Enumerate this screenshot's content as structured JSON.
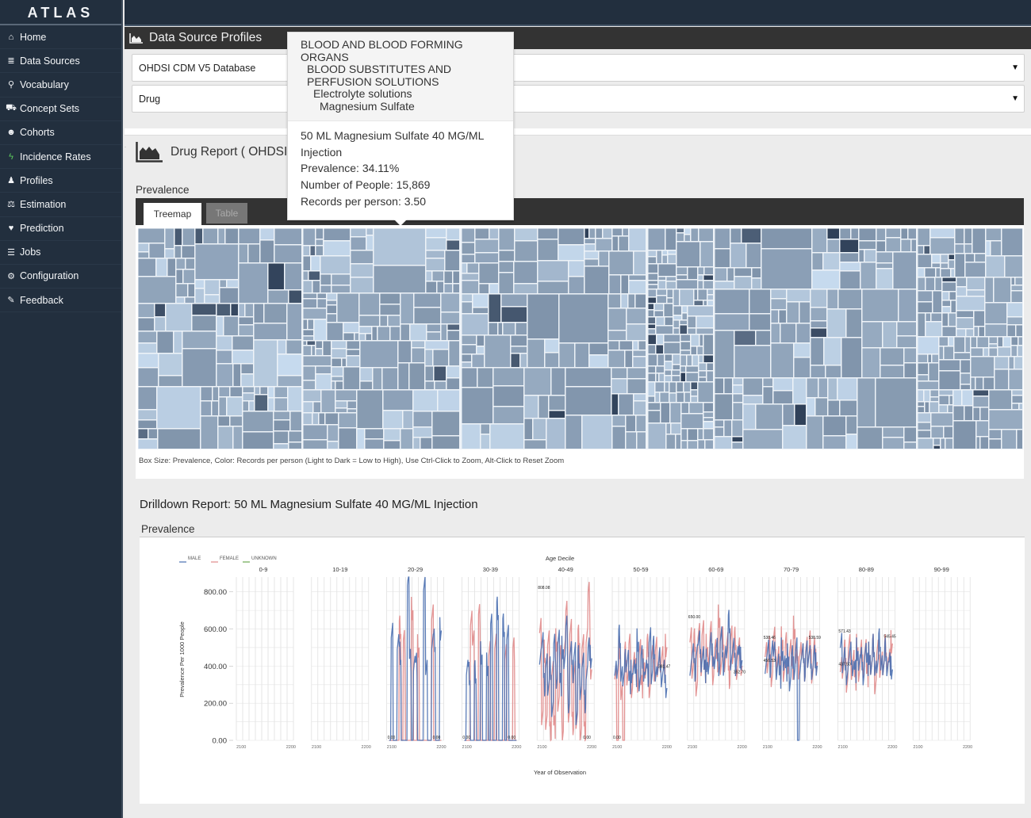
{
  "app": {
    "brand": "ATLAS"
  },
  "sidebar": {
    "items": [
      {
        "label": "Home",
        "icon": "home-icon",
        "glyph": "⌂"
      },
      {
        "label": "Data Sources",
        "icon": "database-icon",
        "glyph": "≣"
      },
      {
        "label": "Vocabulary",
        "icon": "search-icon",
        "glyph": "⚲"
      },
      {
        "label": "Concept Sets",
        "icon": "cart-icon",
        "glyph": "⛟"
      },
      {
        "label": "Cohorts",
        "icon": "users-icon",
        "glyph": "☻"
      },
      {
        "label": "Incidence Rates",
        "icon": "bolt-icon",
        "glyph": "ϟ"
      },
      {
        "label": "Profiles",
        "icon": "user-icon",
        "glyph": "♟"
      },
      {
        "label": "Estimation",
        "icon": "balance-scale-icon",
        "glyph": "⚖"
      },
      {
        "label": "Prediction",
        "icon": "heartbeat-icon",
        "glyph": "♥"
      },
      {
        "label": "Jobs",
        "icon": "tasks-icon",
        "glyph": "☰"
      },
      {
        "label": "Configuration",
        "icon": "cogs-icon",
        "glyph": "⚙"
      },
      {
        "label": "Feedback",
        "icon": "comment-icon",
        "glyph": "✎"
      }
    ]
  },
  "header": {
    "title": "Data Source Profiles"
  },
  "selectors": {
    "source": "OHDSI CDM V5 Database",
    "report": "Drug"
  },
  "report": {
    "title": "Drug Report ( OHDSI-C",
    "prevalence_label": "Prevalence",
    "tabs": [
      {
        "label": "Treemap",
        "active": true
      },
      {
        "label": "Table",
        "active": false
      }
    ],
    "treemap_caption": "Box Size: Prevalence, Color: Records per person (Light to Dark = Low to High), Use Ctrl-Click to Zoom, Alt-Click to Reset Zoom",
    "treemap_colors": {
      "light": "#c6daee",
      "mid": "#7f93aa",
      "dark": "#2d3e56"
    }
  },
  "tooltip": {
    "path": [
      "BLOOD AND BLOOD FORMING ORGANS",
      "BLOOD SUBSTITUTES AND PERFUSION SOLUTIONS",
      "Electrolyte solutions",
      "Magnesium Sulfate"
    ],
    "concept_name": "50 ML Magnesium Sulfate 40 MG/ML Injection",
    "prevalence": "Prevalence: 34.11%",
    "people": "Number of People: 15,869",
    "records": "Records per person: 3.50"
  },
  "drilldown": {
    "title": "Drilldown Report: 50 ML Magnesium Sulfate 40 MG/ML Injection",
    "prevalence_label": "Prevalence"
  },
  "chart_data": {
    "type": "line",
    "title": "Age Decile",
    "xlabel": "Year of Observation",
    "ylabel": "Prevalence Per 1000 People",
    "ylim": [
      0,
      880
    ],
    "yticks": [
      "0.00",
      "200.00",
      "400.00",
      "600.00",
      "800.00"
    ],
    "xticks": [
      "2100",
      "2200"
    ],
    "xlim": [
      2090,
      2205
    ],
    "grid": true,
    "legend": {
      "placement": "top-left",
      "entries": [
        {
          "name": "MALE",
          "color": "#4a6fb0"
        },
        {
          "name": "FEMALE",
          "color": "#e08a8a"
        },
        {
          "name": "UNKNOWN",
          "color": "#6aa84f"
        }
      ]
    },
    "panels": [
      {
        "label": "0-9",
        "annotations": []
      },
      {
        "label": "10-19",
        "annotations": []
      },
      {
        "label": "20-29",
        "annotations": [
          "0.00",
          "0.00"
        ]
      },
      {
        "label": "30-39",
        "annotations": [
          "0.00",
          "0.00"
        ]
      },
      {
        "label": "40-49",
        "annotations": [
          "808.08",
          "0.00"
        ]
      },
      {
        "label": "50-59",
        "annotations": [
          "0.00",
          "381.47"
        ]
      },
      {
        "label": "60-69",
        "annotations": [
          "650.00",
          "352.70"
        ]
      },
      {
        "label": "70-79",
        "annotations": [
          "538.46",
          "538.59",
          "456.53"
        ]
      },
      {
        "label": "80-89",
        "annotations": [
          "571.43",
          "545.45",
          "437.50"
        ]
      },
      {
        "label": "90-99",
        "annotations": []
      }
    ],
    "series_note": "Monthly prevalence per age decile; values approximated from dense line plots",
    "series": [
      {
        "name": "MALE",
        "panel": "20-29",
        "values": [
          0,
          570,
          0,
          0,
          500,
          460,
          0,
          0,
          0,
          880,
          430,
          0,
          410,
          400,
          0,
          0,
          0,
          880,
          370,
          0,
          0,
          500,
          530,
          0,
          0,
          610
        ]
      },
      {
        "name": "FEMALE",
        "panel": "20-29",
        "values": [
          0,
          0,
          0,
          0,
          0,
          600,
          0,
          540,
          0,
          0,
          0,
          710,
          0,
          0,
          500,
          0,
          0,
          0,
          0,
          0,
          0,
          660,
          0,
          0,
          0,
          0
        ]
      },
      {
        "name": "MALE",
        "panel": "30-39",
        "values": [
          0,
          370,
          360,
          0,
          0,
          360,
          0,
          0,
          480,
          0,
          0,
          410,
          0,
          610,
          0,
          0,
          720,
          0,
          0,
          620,
          0,
          550,
          0,
          0,
          0,
          0
        ]
      },
      {
        "name": "FEMALE",
        "panel": "30-39",
        "values": [
          0,
          0,
          0,
          680,
          520,
          0,
          0,
          680,
          0,
          0,
          0,
          0,
          490,
          0,
          0,
          520,
          0,
          0,
          0,
          0,
          500,
          0,
          0,
          0,
          500,
          0
        ]
      },
      {
        "name": "MALE",
        "panel": "40-49",
        "values": [
          480,
          520,
          300,
          450,
          250,
          380,
          180,
          520,
          350,
          560,
          300,
          500,
          420,
          600,
          200,
          480,
          380,
          520,
          100,
          450,
          280,
          400,
          200,
          380,
          500,
          460
        ]
      },
      {
        "name": "FEMALE",
        "panel": "40-49",
        "values": [
          650,
          100,
          480,
          120,
          520,
          30,
          400,
          80,
          550,
          200,
          450,
          60,
          500,
          680,
          150,
          600,
          100,
          420,
          80,
          560,
          50,
          500,
          30,
          580,
          800,
          400
        ]
      },
      {
        "name": "MALE",
        "panel": "50-59",
        "values": [
          420,
          350,
          560,
          380,
          300,
          420,
          460,
          320,
          380,
          400,
          350,
          540,
          300,
          440,
          370,
          380,
          360,
          600,
          320,
          500,
          380,
          360,
          430,
          340,
          380,
          300
        ]
      },
      {
        "name": "FEMALE",
        "panel": "50-59",
        "values": [
          400,
          0,
          500,
          280,
          0,
          460,
          350,
          520,
          300,
          440,
          380,
          320,
          500,
          280,
          420,
          360,
          520,
          300,
          450,
          380,
          540,
          350,
          420,
          480,
          380,
          520
        ]
      },
      {
        "name": "MALE",
        "panel": "60-69",
        "values": [
          420,
          460,
          380,
          500,
          520,
          420,
          480,
          380,
          440,
          400,
          520,
          460,
          420,
          480,
          400,
          560,
          420,
          500,
          460,
          640,
          440,
          480,
          400,
          480,
          460,
          450
        ]
      },
      {
        "name": "FEMALE",
        "panel": "60-69",
        "values": [
          600,
          350,
          540,
          300,
          560,
          400,
          620,
          380,
          520,
          440,
          580,
          360,
          500,
          420,
          660,
          380,
          560,
          440,
          520,
          340,
          600,
          420,
          540,
          380,
          500,
          420
        ]
      },
      {
        "name": "MALE",
        "panel": "70-79",
        "values": [
          430,
          480,
          400,
          520,
          460,
          380,
          440,
          350,
          500,
          420,
          380,
          460,
          300,
          440,
          380,
          500,
          0,
          420,
          460,
          380,
          520,
          400,
          440,
          380,
          460,
          420
        ]
      },
      {
        "name": "FEMALE",
        "panel": "70-79",
        "values": [
          520,
          380,
          500,
          350,
          540,
          420,
          480,
          400,
          560,
          360,
          520,
          420,
          500,
          380,
          600,
          440,
          400,
          520,
          460,
          380,
          540,
          400,
          520,
          360,
          500,
          440
        ]
      },
      {
        "name": "MALE",
        "panel": "80-89",
        "values": [
          570,
          380,
          440,
          360,
          420,
          460,
          400,
          380,
          500,
          420,
          440,
          360,
          480,
          400,
          460,
          380,
          520,
          420,
          380,
          540,
          440,
          360,
          480,
          400,
          420,
          400
        ]
      },
      {
        "name": "FEMALE",
        "panel": "80-89",
        "values": [
          440,
          350,
          480,
          320,
          500,
          380,
          460,
          340,
          520,
          360,
          480,
          400,
          500,
          340,
          460,
          380,
          520,
          320,
          480,
          400,
          460,
          360,
          500,
          420,
          440,
          540
        ]
      }
    ]
  }
}
